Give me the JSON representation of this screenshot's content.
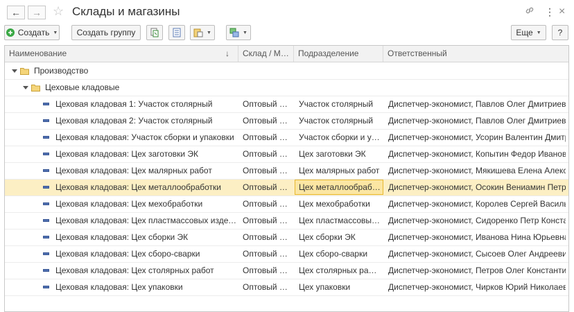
{
  "window": {
    "title": "Склады и магазины",
    "back_icon": "←",
    "forward_icon": "→",
    "star_icon": "☆",
    "link_icon": "🔗",
    "more_icon": "⋮",
    "close_icon": "×"
  },
  "toolbar": {
    "create_label": "Создать",
    "create_group_label": "Создать группу",
    "more_label": "Еще",
    "help_label": "?"
  },
  "table": {
    "columns": [
      "Наименование",
      "Склад / Магазин",
      "Подразделение",
      "Ответственный"
    ],
    "sort_icon": "↓",
    "groups": [
      {
        "name": "Производство"
      },
      {
        "name": "Цеховые кладовые"
      }
    ],
    "rows": [
      {
        "name": "Цеховая кладовая 1: Участок столярный",
        "type": "Оптовый склад",
        "dept": "Участок столярный",
        "resp": "Диспетчер-экономист, Павлов Олег Дмитриевич"
      },
      {
        "name": "Цеховая кладовая 2: Участок столярный",
        "type": "Оптовый склад",
        "dept": "Участок столярный",
        "resp": "Диспетчер-экономист, Павлов Олег Дмитриевич"
      },
      {
        "name": "Цеховая кладовая: Участок сборки и упаковки",
        "type": "Оптовый склад",
        "dept": "Участок сборки и упаковки",
        "resp": "Диспетчер-экономист, Усорин Валентин Дмитриевич"
      },
      {
        "name": "Цеховая кладовая: Цех заготовки ЭК",
        "type": "Оптовый склад",
        "dept": "Цех заготовки ЭК",
        "resp": "Диспетчер-экономист, Копытин Федор Иванович"
      },
      {
        "name": "Цеховая кладовая: Цех малярных работ",
        "type": "Оптовый склад",
        "dept": "Цех малярных работ",
        "resp": "Диспетчер-экономист, Мякишева Елена Александровна"
      },
      {
        "name": "Цеховая кладовая: Цех металлообработки",
        "type": "Оптовый склад",
        "dept": "Цех металлообработки",
        "resp": "Диспетчер-экономист, Осокин Вениамин Петрович"
      },
      {
        "name": "Цеховая кладовая: Цех мехобработки",
        "type": "Оптовый склад",
        "dept": "Цех мехобработки",
        "resp": "Диспетчер-экономист, Королев Сергей Васильевич"
      },
      {
        "name": "Цеховая кладовая: Цех пластмассовых изделий",
        "type": "Оптовый склад",
        "dept": "Цех пластмассовых изделий",
        "resp": "Диспетчер-экономист, Сидоренко Петр Константинович"
      },
      {
        "name": "Цеховая кладовая: Цех сборки ЭК",
        "type": "Оптовый склад",
        "dept": "Цех сборки ЭК",
        "resp": "Диспетчер-экономист, Иванова Нина Юрьевна"
      },
      {
        "name": "Цеховая кладовая: Цех сборо-сварки",
        "type": "Оптовый склад",
        "dept": "Цех сборо-сварки",
        "resp": "Диспетчер-экономист, Сысоев Олег Андреевич"
      },
      {
        "name": "Цеховая кладовая: Цех столярных работ",
        "type": "Оптовый склад",
        "dept": "Цех столярных работ",
        "resp": "Диспетчер-экономист, Петров Олег Константинович"
      },
      {
        "name": "Цеховая кладовая: Цех упаковки",
        "type": "Оптовый склад",
        "dept": "Цех упаковки",
        "resp": "Диспетчер-экономист, Чирков Юрий Николаевич"
      }
    ]
  }
}
